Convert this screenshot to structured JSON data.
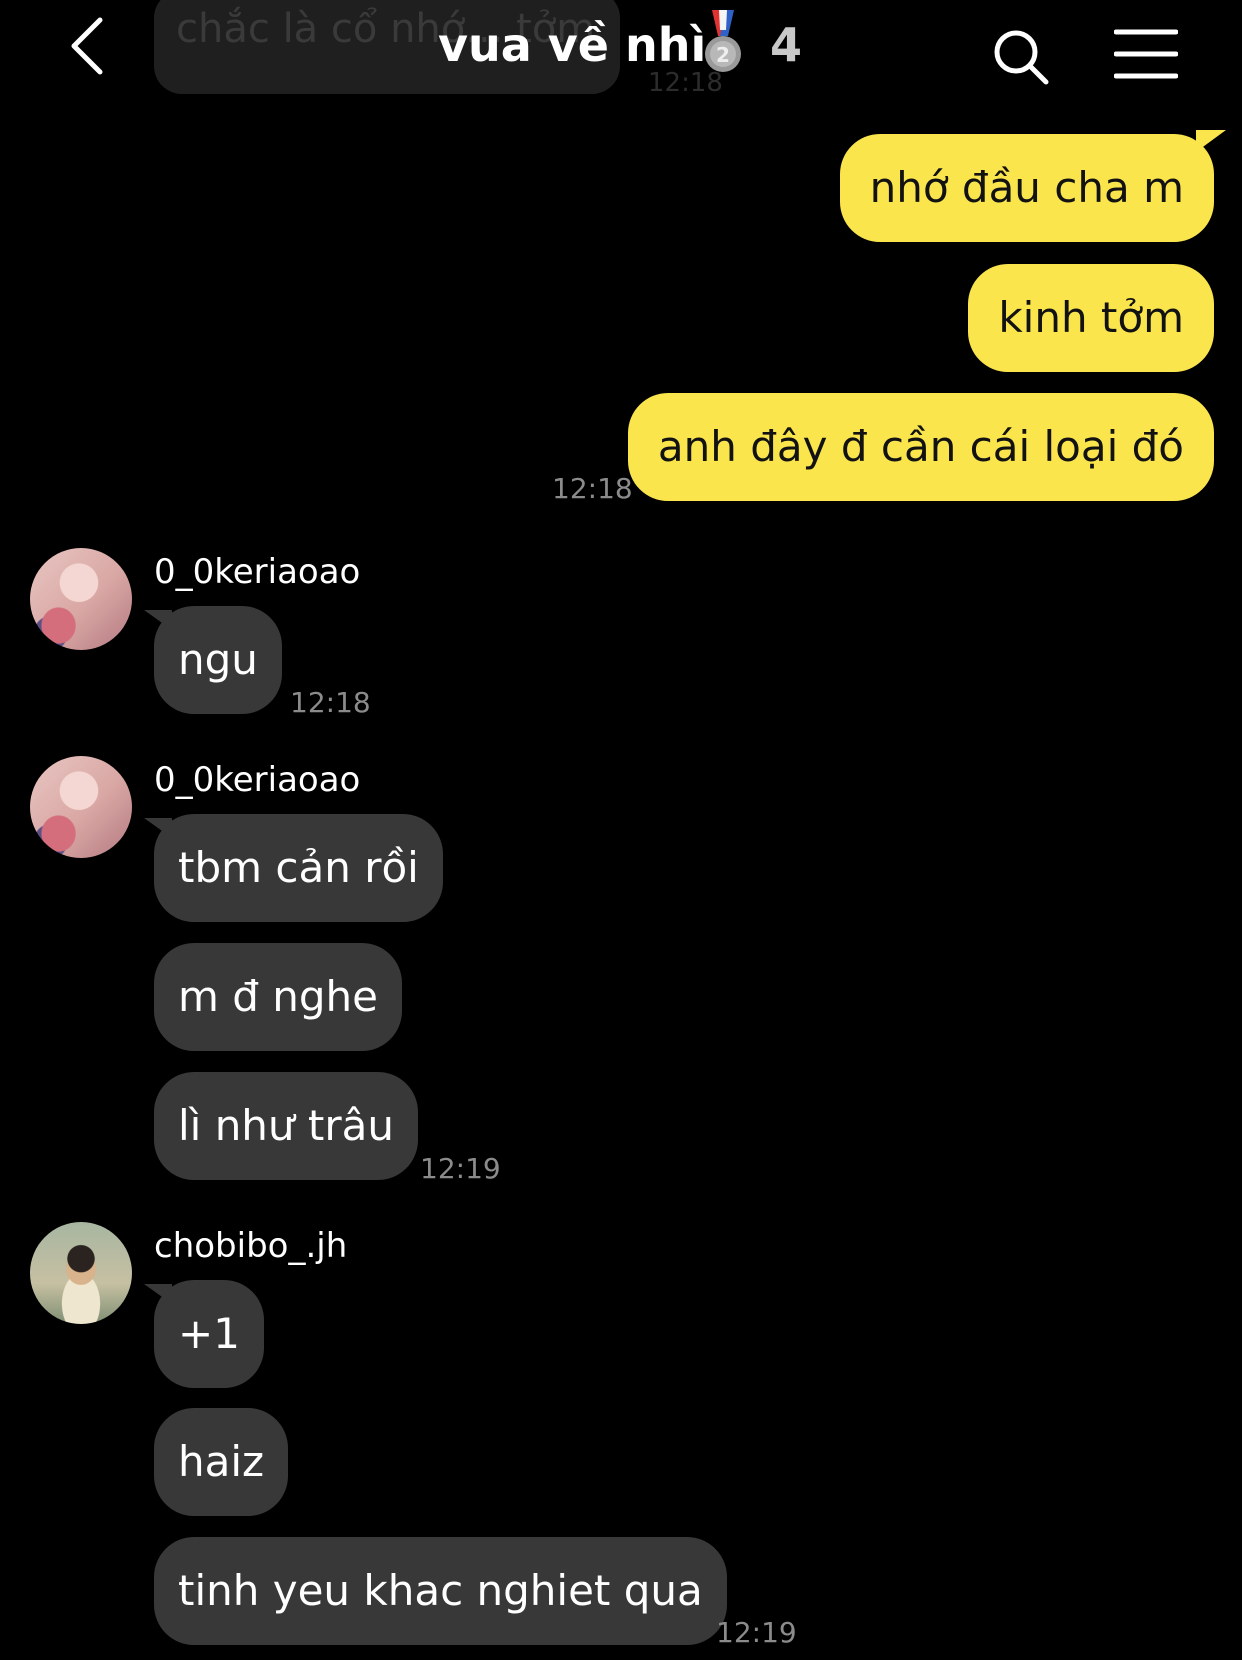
{
  "header": {
    "title": "vua về nhì",
    "member_count": "4",
    "background_message": "chắc là cổ nhớ... tởm",
    "background_time": "12:18"
  },
  "messages_mine": [
    {
      "text": "nhớ đầu cha m"
    },
    {
      "text": "kinh tởm"
    },
    {
      "text": "anh đây đ cần cái loại đó",
      "time": "12:18"
    }
  ],
  "groups": [
    {
      "sender": "0_0keriaoao",
      "avatar": "avatar-face",
      "messages": [
        "ngu"
      ],
      "time": "12:18"
    },
    {
      "sender": "0_0keriaoao",
      "avatar": "avatar-face",
      "messages": [
        "tbm cản rồi",
        "m đ nghe",
        "lì như trâu"
      ],
      "time": "12:19"
    },
    {
      "sender": "chobibo_.jh",
      "avatar": "avatar-kid",
      "messages": [
        "+1",
        "haiz",
        "tinh yeu khac nghiet qua"
      ],
      "time": "12:19"
    }
  ],
  "colors": {
    "background": "#000000",
    "my_bubble": "#fbe54d",
    "their_bubble": "#383838",
    "timestamp": "#8b8b8b"
  },
  "icons": [
    "back-arrow-icon",
    "medal-silver-2-icon",
    "search-icon",
    "menu-icon"
  ]
}
